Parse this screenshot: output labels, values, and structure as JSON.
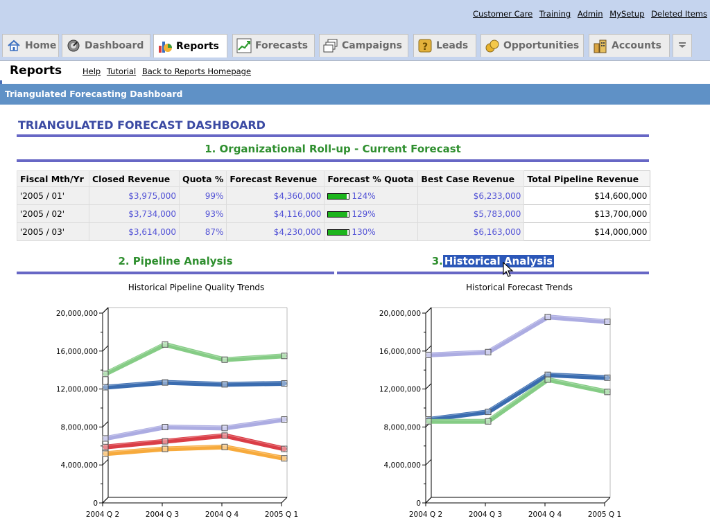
{
  "header": {
    "links": [
      "Customer Care",
      "Training",
      "Admin",
      "MySetup",
      "Deleted Items"
    ]
  },
  "tabs": [
    {
      "label": "Home",
      "icon": "home-icon",
      "active": false
    },
    {
      "label": "Dashboard",
      "icon": "dashboard-icon",
      "active": false
    },
    {
      "label": "Reports",
      "icon": "reports-icon",
      "active": true
    },
    {
      "label": "Forecasts",
      "icon": "forecasts-icon",
      "active": false
    },
    {
      "label": "Campaigns",
      "icon": "campaigns-icon",
      "active": false
    },
    {
      "label": "Leads",
      "icon": "leads-icon",
      "active": false
    },
    {
      "label": "Opportunities",
      "icon": "opportunities-icon",
      "active": false
    },
    {
      "label": "Accounts",
      "icon": "accounts-icon",
      "active": false
    }
  ],
  "page": {
    "title": "Reports",
    "links": [
      "Help",
      "Tutorial",
      "Back to Reports Homepage"
    ],
    "dashboard_bar": "Triangulated Forecasting Dashboard",
    "dashboard_title": "TRIANGULATED FORECAST DASHBOARD"
  },
  "sections": {
    "rollup": "1. Organizational Roll-up - Current Forecast",
    "pipeline": "2. Pipeline Analysis",
    "historical_prefix": "3.",
    "historical_highlight": "Historical Analysis"
  },
  "table": {
    "headers": [
      "Fiscal Mth/Yr",
      "Closed Revenue",
      "Quota %",
      "Forecast Revenue",
      "Forecast % Quota",
      "Best Case Revenue",
      "Total Pipeline Revenue"
    ],
    "rows": [
      {
        "period": "'2005 / 01'",
        "closed": "$3,975,000",
        "quota": "99%",
        "forecast": "$4,360,000",
        "fq_pct": "124%",
        "fq_value": 124,
        "best": "$6,233,000",
        "pipeline": "$14,600,000"
      },
      {
        "period": "'2005 / 02'",
        "closed": "$3,734,000",
        "quota": "93%",
        "forecast": "$4,116,000",
        "fq_pct": "129%",
        "fq_value": 129,
        "best": "$5,783,000",
        "pipeline": "$13,700,000"
      },
      {
        "period": "'2005 / 03'",
        "closed": "$3,614,000",
        "quota": "87%",
        "forecast": "$4,230,000",
        "fq_pct": "130%",
        "fq_value": 130,
        "best": "$6,163,000",
        "pipeline": "$14,000,000"
      }
    ]
  },
  "chart_data": [
    {
      "type": "line",
      "title": "Historical Pipeline Quality Trends",
      "categories": [
        "2004 Q 2",
        "2004 Q 3",
        "2004 Q 4",
        "2005 Q 1"
      ],
      "ylim": [
        0,
        20000000
      ],
      "yticks": [
        "0",
        "4,000,000",
        "8,000,000",
        "12,000,000",
        "16,000,000",
        "20,000,000"
      ],
      "grid": false,
      "series": [
        {
          "color": "#7ec97e",
          "values": [
            13300000,
            16400000,
            14800000,
            15200000
          ]
        },
        {
          "color": "#2f64ac",
          "values": [
            11900000,
            12400000,
            12200000,
            12300000
          ]
        },
        {
          "color": "#a8a8e0",
          "values": [
            6500000,
            7700000,
            7600000,
            8500000
          ]
        },
        {
          "color": "#d8333c",
          "values": [
            5600000,
            6200000,
            6800000,
            5400000
          ]
        },
        {
          "color": "#f7a531",
          "values": [
            4900000,
            5400000,
            5600000,
            4400000
          ]
        }
      ]
    },
    {
      "type": "line",
      "title": "Historical Forecast Trends",
      "categories": [
        "2004 Q 2",
        "2004 Q 3",
        "2004 Q 4",
        "2005 Q 1"
      ],
      "ylim": [
        0,
        20000000
      ],
      "yticks": [
        "0",
        "4,000,000",
        "8,000,000",
        "12,000,000",
        "16,000,000",
        "20,000,000"
      ],
      "grid": false,
      "series": [
        {
          "color": "#a8a8e0",
          "values": [
            15300000,
            15600000,
            19300000,
            18800000
          ]
        },
        {
          "color": "#2f64ac",
          "values": [
            8500000,
            9300000,
            13200000,
            12900000
          ]
        },
        {
          "color": "#7ec97e",
          "values": [
            8300000,
            8300000,
            12700000,
            11400000
          ]
        }
      ]
    }
  ]
}
